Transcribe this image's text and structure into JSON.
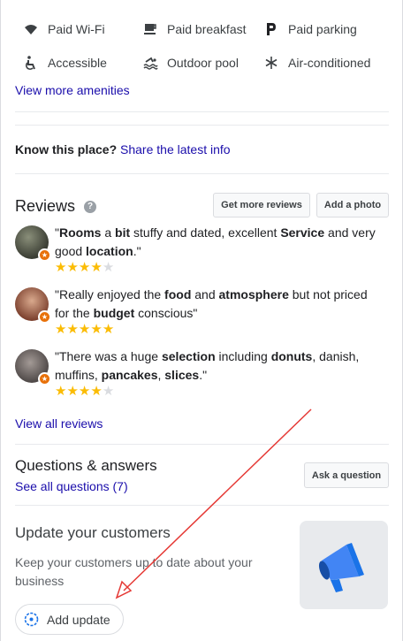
{
  "amenities": [
    {
      "icon": "wifi-icon",
      "label": "Paid Wi-Fi"
    },
    {
      "icon": "coffee-cup-icon",
      "label": "Paid breakfast"
    },
    {
      "icon": "parking-icon",
      "label": "Paid parking"
    },
    {
      "icon": "accessible-icon",
      "label": "Accessible"
    },
    {
      "icon": "pool-icon",
      "label": "Outdoor pool"
    },
    {
      "icon": "snowflake-icon",
      "label": "Air-conditioned"
    }
  ],
  "view_more_amenities": "View more amenities",
  "know_place": {
    "prompt": "Know this place?",
    "link": "Share the latest info"
  },
  "reviews": {
    "title": "Reviews",
    "get_more_label": "Get more reviews",
    "add_photo_label": "Add a photo",
    "items": [
      {
        "rating": 4,
        "max": 5
      },
      {
        "rating": 5,
        "max": 5
      },
      {
        "rating": 4,
        "max": 5
      }
    ],
    "view_all": "View all reviews"
  },
  "qa": {
    "title": "Questions & answers",
    "see_all": "See all questions (7)",
    "ask_label": "Ask a question"
  },
  "update": {
    "title": "Update your customers",
    "description": "Keep your customers up to date about your business",
    "button_label": "Add update"
  },
  "colors": {
    "link": "#1a0dab",
    "star": "#fbbc04",
    "badge": "#e8710a",
    "annotation": "#e53935"
  }
}
